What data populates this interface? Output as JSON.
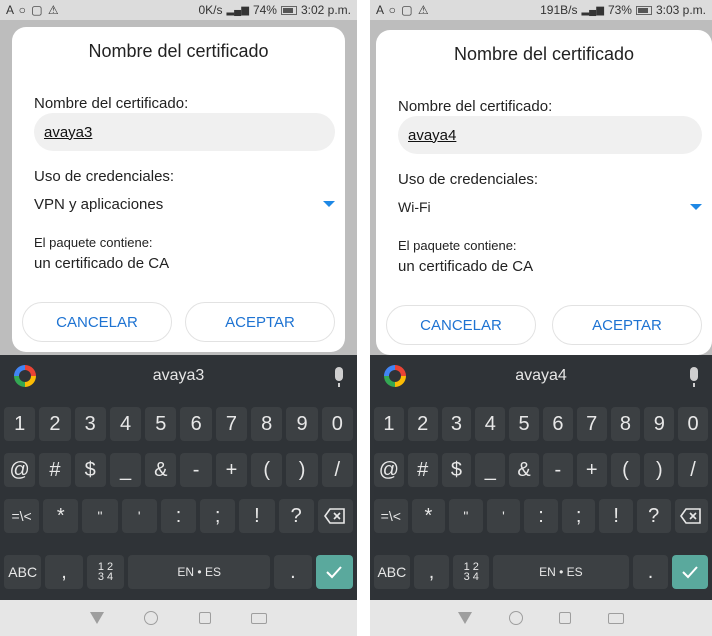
{
  "screens": [
    {
      "status": {
        "left_icons": "A ○ ▢ ⚠",
        "speed": "0K/s",
        "signal": "📶",
        "battery_pct": "74%",
        "time": "3:02 p.m."
      },
      "dialog": {
        "title": "Nombre del certificado",
        "name_label": "Nombre del certificado:",
        "name_value": "avaya3",
        "usage_label": "Uso de credenciales:",
        "usage_value": "VPN y aplicaciones",
        "package_label": "El paquete contiene:",
        "package_value": "un certificado de CA",
        "cancel_label": "CANCELAR",
        "accept_label": "ACEPTAR"
      },
      "keyboard": {
        "suggestion": "avaya3"
      }
    },
    {
      "status": {
        "left_icons": "A ○ ▢ ⚠",
        "speed": "191B/s",
        "signal": "📶",
        "battery_pct": "73%",
        "time": "3:03 p.m."
      },
      "dialog": {
        "title": "Nombre del certificado",
        "name_label": "Nombre del certificado:",
        "name_value": "avaya4",
        "usage_label": "Uso de credenciales:",
        "usage_value": "Wi-Fi",
        "package_label": "El paquete contiene:",
        "package_value": "un certificado de CA",
        "cancel_label": "CANCELAR",
        "accept_label": "ACEPTAR"
      },
      "keyboard": {
        "suggestion": "avaya4"
      }
    }
  ],
  "keyboard": {
    "row1": [
      "1",
      "2",
      "3",
      "4",
      "5",
      "6",
      "7",
      "8",
      "9",
      "0"
    ],
    "row2": [
      "@",
      "#",
      "$",
      "_",
      "&",
      "-",
      "+",
      "(",
      ")",
      "/"
    ],
    "row3": [
      "=\\<",
      "*",
      "\"",
      "'",
      ":",
      ";",
      "!",
      "?"
    ],
    "abc": "ABC",
    "comma": ",",
    "fraction_top": "1 2",
    "fraction_bottom": "3 4",
    "space": "EN • ES",
    "period": "."
  },
  "colors": {
    "accent": "#1e73d2",
    "enter": "#5aa99d",
    "keyboard_bg": "#2f3337"
  },
  "icons": {
    "assistant": "google-g-icon",
    "mic": "mic-icon",
    "backspace": "backspace-icon",
    "enter": "checkmark-icon"
  }
}
